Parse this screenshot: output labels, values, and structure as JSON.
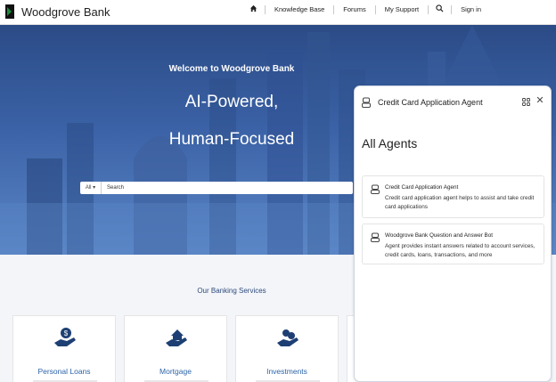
{
  "header": {
    "brand": "Woodgrove Bank",
    "logo_icon": "woodgrove-logo",
    "nav": [
      "Knowledge Base",
      "Forums",
      "My Support"
    ],
    "sign_in": "Sign in",
    "home_icon": "home-icon",
    "search_icon": "search-icon"
  },
  "hero": {
    "welcome": "Welcome to Woodgrove Bank",
    "headline_1": "AI-Powered,",
    "headline_2": "Human-Focused",
    "search_scope": "All ▾",
    "search_placeholder": "Search"
  },
  "services": {
    "title": "Our Banking Services",
    "cards": [
      {
        "label": "Personal Loans",
        "icon": "personal-loan-icon"
      },
      {
        "label": "Mortgage",
        "icon": "mortgage-icon"
      },
      {
        "label": "Investments",
        "icon": "investments-icon"
      }
    ]
  },
  "agent_panel": {
    "title": "Credit Card Application Agent",
    "heading": "All Agents",
    "agents": [
      {
        "name": "Credit Card Application Agent",
        "description": "Credit card application agent helps to assist and take credit card applications"
      },
      {
        "name": "Woodgrove Bank Question and Answer Bot",
        "description": "Agent provides instant answers related to account services, credit cards, loans, transactions, and more"
      }
    ]
  },
  "colors": {
    "hero_top": "#2b4b86",
    "hero_bottom": "#5a86c7",
    "service_label": "#2d64a8",
    "service_title": "#2e4a7a",
    "logo_green": "#1e8c3a"
  }
}
